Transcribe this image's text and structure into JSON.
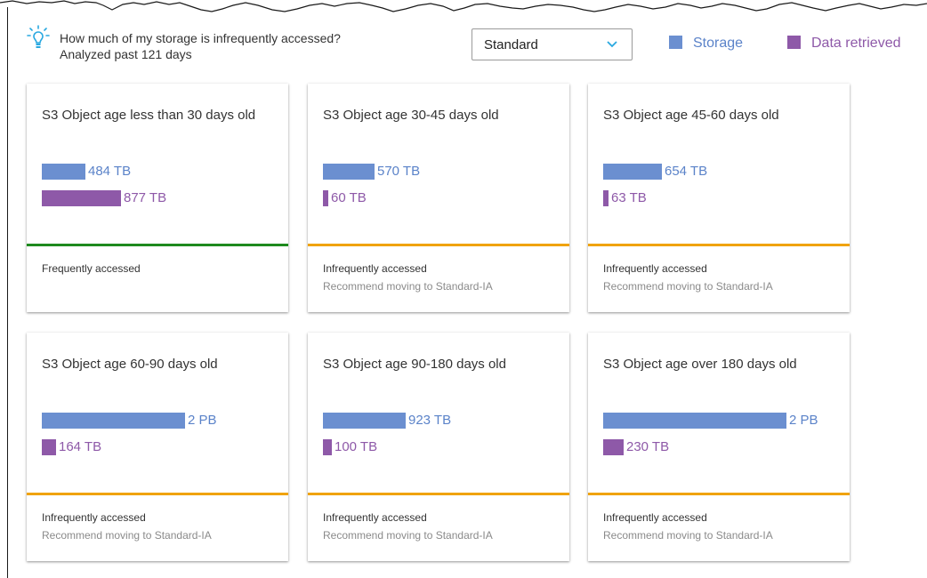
{
  "header": {
    "question": "How much of my storage is infrequently accessed?",
    "subtitle": "Analyzed past 121 days",
    "storage_class_select": {
      "selected": "Standard"
    }
  },
  "legend": [
    {
      "label": "Storage",
      "color": "#5b83c9"
    },
    {
      "label": "Data retrieved",
      "color": "#8e59a8"
    }
  ],
  "colors": {
    "storage_bar": "#6b8fd0",
    "retrieved_bar": "#8e59a8",
    "frequent_status": "#1e8a1e",
    "infrequent_status": "#f0a30a"
  },
  "cards": [
    {
      "title": "S3 Object age less than 30 days old",
      "storage_label": "484 TB",
      "storage_fraction": 0.24,
      "retrieved_label": "877 TB",
      "retrieved_fraction": 0.43,
      "status": "Frequently accessed",
      "recommendation": "",
      "status_type": "frequent"
    },
    {
      "title": "S3 Object age 30-45 days old",
      "storage_label": "570 TB",
      "storage_fraction": 0.28,
      "retrieved_label": "60 TB",
      "retrieved_fraction": 0.03,
      "status": "Infrequently accessed",
      "recommendation": "Recommend moving to Standard-IA",
      "status_type": "infrequent"
    },
    {
      "title": "S3 Object age 45-60 days old",
      "storage_label": "654 TB",
      "storage_fraction": 0.32,
      "retrieved_label": "63 TB",
      "retrieved_fraction": 0.03,
      "status": "Infrequently accessed",
      "recommendation": "Recommend moving to Standard-IA",
      "status_type": "infrequent"
    },
    {
      "title": "S3 Object age 60-90 days old",
      "storage_label": "2 PB",
      "storage_fraction": 0.78,
      "retrieved_label": "164 TB",
      "retrieved_fraction": 0.08,
      "status": "Infrequently accessed",
      "recommendation": "Recommend moving to Standard-IA",
      "status_type": "infrequent"
    },
    {
      "title": "S3 Object age 90-180 days old",
      "storage_label": "923 TB",
      "storage_fraction": 0.45,
      "retrieved_label": "100 TB",
      "retrieved_fraction": 0.05,
      "status": "Infrequently accessed",
      "recommendation": "Recommend moving to Standard-IA",
      "status_type": "infrequent"
    },
    {
      "title": "S3 Object age over 180 days old",
      "storage_label": "2 PB",
      "storage_fraction": 1.0,
      "retrieved_label": "230 TB",
      "retrieved_fraction": 0.11,
      "status": "Infrequently accessed",
      "recommendation": "Recommend moving to Standard-IA",
      "status_type": "infrequent"
    }
  ]
}
